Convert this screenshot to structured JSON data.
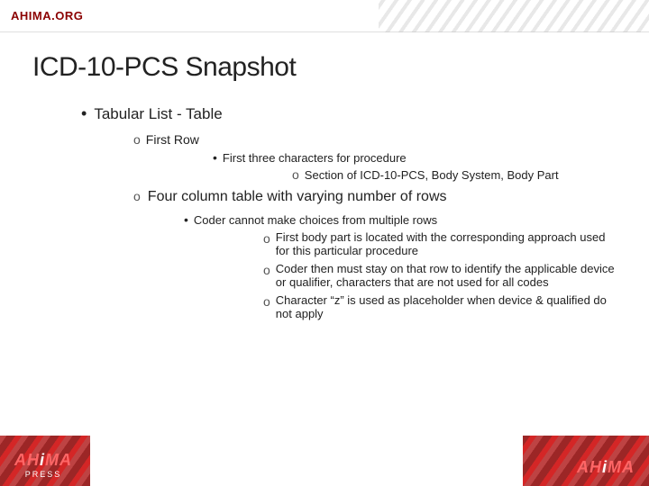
{
  "header": {
    "logo": "AHIMA.ORG"
  },
  "page": {
    "title": "ICD-10-PCS Snapshot",
    "bullet1": {
      "label": "Tabular List - Table",
      "sub1": {
        "label": "First Row",
        "sub1a": {
          "label": "First three characters for procedure",
          "sub1a1": "Section of ICD-10-PCS, Body System, Body Part"
        }
      },
      "sub2": {
        "label": "Four column table with varying number of rows",
        "sub2a": {
          "label": "Coder cannot make choices from multiple rows",
          "items": [
            "First body part is located with the corresponding approach used for this particular procedure",
            "Coder then must stay on that row to identify the applicable device or qualifier, characters that are not used for all codes",
            "Character “z” is used as placeholder when device & qualified do not apply"
          ]
        }
      }
    }
  },
  "footer": {
    "logo_left_line1": "AHiMA",
    "logo_left_line2": "PRESS",
    "logo_right": "AHiMA"
  }
}
